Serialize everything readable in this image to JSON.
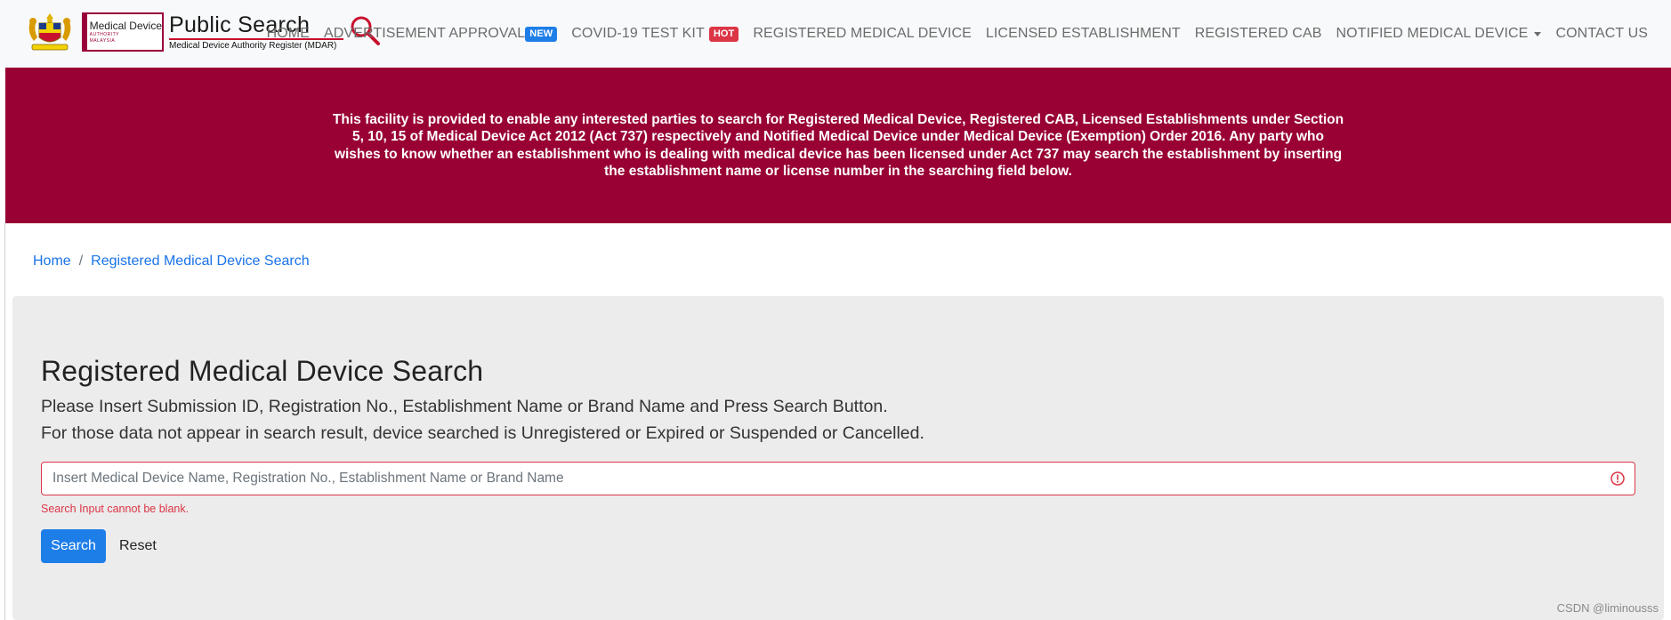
{
  "brand": {
    "mda_title": "Medical Device",
    "mda_sub_1": "AUTHORITY",
    "mda_sub_2": "MALAYSIA",
    "title": "Public Search",
    "subtitle": "Medical Device Authority Register (MDAR)"
  },
  "nav": {
    "home": "HOME",
    "advertisement": "ADVERTISEMENT APPROVAL",
    "new_badge": "NEW",
    "covid": "COVID-19 TEST KIT",
    "hot_badge": "HOT",
    "registered_device": "REGISTERED MEDICAL DEVICE",
    "licensed": "LICENSED ESTABLISHMENT",
    "cab": "REGISTERED CAB",
    "notified": "NOTIFIED MEDICAL DEVICE",
    "contact": "CONTACT US"
  },
  "banner": {
    "t1": "This facility is provided to enable any interested parties to search for ",
    "b1": "Registered Medical Device, Registered CAB, Licensed Establishments",
    "t2": " under Section 5, 10, 15 of Medical Device Act 2012 (Act 737) respectively and Notified Medical Device under Medical Device (Exemption) Order 2016. Any party who wishes to know whether an establishment who is dealing with medical device has been licensed under Act 737 may search the establishment by inserting the establishment name or license number in the searching field below."
  },
  "breadcrumb": {
    "home": "Home",
    "separator": "/",
    "current": "Registered Medical Device Search"
  },
  "main": {
    "title": "Registered Medical Device Search",
    "line1": "Please Insert Submission ID, Registration No., Establishment Name or Brand Name and Press Search Button.",
    "line2": "For those data not appear in search result, device searched is Unregistered or Expired or Suspended or Cancelled.",
    "search_placeholder": "Insert Medical Device Name, Registration No., Establishment Name or Brand Name",
    "search_value": "",
    "error": "Search Input cannot be blank.",
    "search_button": "Search",
    "reset_button": "Reset"
  },
  "watermark": "CSDN @liminousss",
  "colors": {
    "brand_maroon": "#990033",
    "primary_blue": "#1e7ee8",
    "danger_red": "#dc3545",
    "jumbo_bg": "#ececec"
  },
  "icons": {
    "coat_of_arms": "coat-of-arms-icon",
    "magnifier": "magnifier-icon",
    "error": "exclamation-circle-icon",
    "dropdown": "caret-down-icon"
  }
}
